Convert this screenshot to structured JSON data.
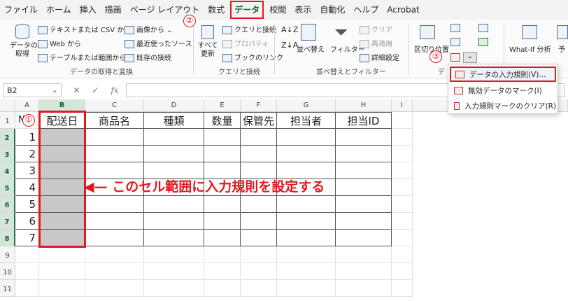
{
  "menu": {
    "tabs": [
      "ファイル",
      "ホーム",
      "挿入",
      "描画",
      "ページ レイアウト",
      "数式",
      "データ",
      "校閲",
      "表示",
      "自動化",
      "ヘルプ",
      "Acrobat"
    ],
    "active": "データ"
  },
  "ribbon": {
    "get_data": {
      "big_button": "データの\n取得",
      "items": [
        "テキストまたは CSV から",
        "Web から",
        "テーブルまたは範囲から",
        "画像から",
        "最近使ったソース",
        "既存の接続"
      ],
      "group_label": "データの取得と変換"
    },
    "queries": {
      "refresh_all": "すべて\n更新",
      "items": [
        "クエリと接続",
        "プロパティ",
        "ブックのリンク"
      ],
      "group_label": "クエリと接続"
    },
    "sort_filter": {
      "sort": "並べ替え",
      "filter": "フィルター",
      "items": [
        "クリア",
        "再適用",
        "詳細設定"
      ],
      "group_label": "並べ替えとフィルター"
    },
    "data_tools": {
      "text_to_columns": "区切り位置",
      "group_label_partial": "デ"
    },
    "forecast": {
      "whatif": "What-If 分析",
      "forecast_sheet_partial": "予"
    }
  },
  "callouts": [
    "①",
    "②",
    "③"
  ],
  "dropdown": {
    "items": [
      "データの入力規則(V)...",
      "無効データのマーク(I)",
      "入力規則マークのクリア(R)"
    ],
    "highlighted_index": 0
  },
  "formula_bar": {
    "name_box": "B2",
    "fx": "fx",
    "value": ""
  },
  "sheet": {
    "columns": [
      "A",
      "B",
      "C",
      "D",
      "E",
      "F",
      "G",
      "H",
      "I"
    ],
    "selected_column": "B",
    "rows": [
      "1",
      "2",
      "3",
      "4",
      "5",
      "6",
      "7",
      "8",
      "9",
      "10",
      "11"
    ],
    "selected_rows": [
      "2",
      "3",
      "4",
      "5",
      "6",
      "7",
      "8"
    ],
    "table_headers": [
      "配送日",
      "商品名",
      "種類",
      "数量",
      "保管先",
      "担当者",
      "担当ID"
    ],
    "a1_partial": "N",
    "row_numbers": [
      "1",
      "2",
      "3",
      "4",
      "5",
      "6",
      "7"
    ]
  },
  "annotation": "◀— このセル範囲に入力規則を設定する",
  "annotation_text": "このセル範囲に入力規則を設定する",
  "colors": {
    "accent_red": "#e0191f",
    "excel_green": "#217346",
    "selection_fill": "#c8c8c8"
  }
}
